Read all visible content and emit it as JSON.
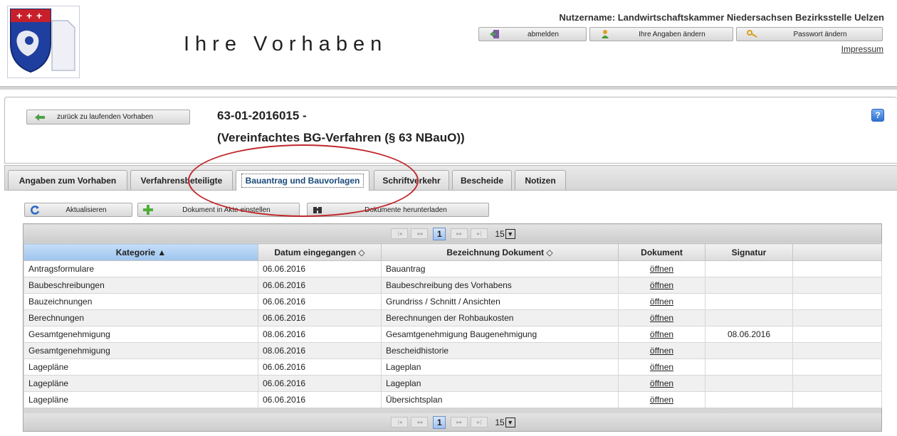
{
  "header": {
    "title": "Ihre Vorhaben",
    "username_text": "Nutzername: Landwirtschaftskammer Niedersachsen Bezirksstelle Uelzen",
    "buttons": [
      {
        "label": "abmelden",
        "icon": "logout-icon"
      },
      {
        "label": "Ihre Angaben ändern",
        "icon": "user-edit-icon"
      },
      {
        "label": "Passwort ändern",
        "icon": "key-icon"
      }
    ],
    "impressum": "Impressum"
  },
  "project": {
    "back_label": "zurück zu laufenden Vorhaben",
    "number": "63-01-2016015 -",
    "type": "(Vereinfachtes BG-Verfahren (§ 63 NBauO))",
    "help": "?"
  },
  "tabs": [
    {
      "label": "Angaben zum Vorhaben"
    },
    {
      "label": "Verfahrensbeteiligte"
    },
    {
      "label": "Bauantrag und Bauvorlagen",
      "active": true
    },
    {
      "label": "Schriftverkehr"
    },
    {
      "label": "Bescheide"
    },
    {
      "label": "Notizen"
    }
  ],
  "toolbar": {
    "refresh_label": "Aktualisieren",
    "add_label": "Dokument in Akte einstellen",
    "download_label": "Dokumente herunterladen"
  },
  "pager": {
    "current_page": "1",
    "page_size": "15"
  },
  "table": {
    "headers": {
      "kategorie": "Kategorie ▲",
      "datum": "Datum eingegangen ◇",
      "bezeichnung": "Bezeichnung Dokument ◇",
      "dokument": "Dokument",
      "signatur": "Signatur"
    },
    "rows": [
      {
        "kategorie": "Antragsformulare",
        "datum": "06.06.2016",
        "bezeichnung": "Bauantrag",
        "dokument": "öffnen",
        "signatur": ""
      },
      {
        "kategorie": "Baubeschreibungen",
        "datum": "06.06.2016",
        "bezeichnung": "Baubeschreibung des Vorhabens",
        "dokument": "öffnen",
        "signatur": ""
      },
      {
        "kategorie": "Bauzeichnungen",
        "datum": "06.06.2016",
        "bezeichnung": "Grundriss / Schnitt / Ansichten",
        "dokument": "öffnen",
        "signatur": ""
      },
      {
        "kategorie": "Berechnungen",
        "datum": "06.06.2016",
        "bezeichnung": "Berechnungen der Rohbaukosten",
        "dokument": "öffnen",
        "signatur": ""
      },
      {
        "kategorie": "Gesamtgenehmigung",
        "datum": "08.06.2016",
        "bezeichnung": "Gesamtgenehmigung Baugenehmigung",
        "dokument": "öffnen",
        "signatur": "08.06.2016"
      },
      {
        "kategorie": "Gesamtgenehmigung",
        "datum": "08.06.2016",
        "bezeichnung": "Bescheidhistorie",
        "dokument": "öffnen",
        "signatur": ""
      },
      {
        "kategorie": "Lagepläne",
        "datum": "06.06.2016",
        "bezeichnung": "Lageplan",
        "dokument": "öffnen",
        "signatur": ""
      },
      {
        "kategorie": "Lagepläne",
        "datum": "06.06.2016",
        "bezeichnung": "Lageplan",
        "dokument": "öffnen",
        "signatur": ""
      },
      {
        "kategorie": "Lagepläne",
        "datum": "06.06.2016",
        "bezeichnung": "Übersichtsplan",
        "dokument": "öffnen",
        "signatur": ""
      }
    ]
  },
  "colors": {
    "accent_sorted": "#9ec4ee",
    "annotation": "#c0282c",
    "help": "#2e73d2"
  }
}
